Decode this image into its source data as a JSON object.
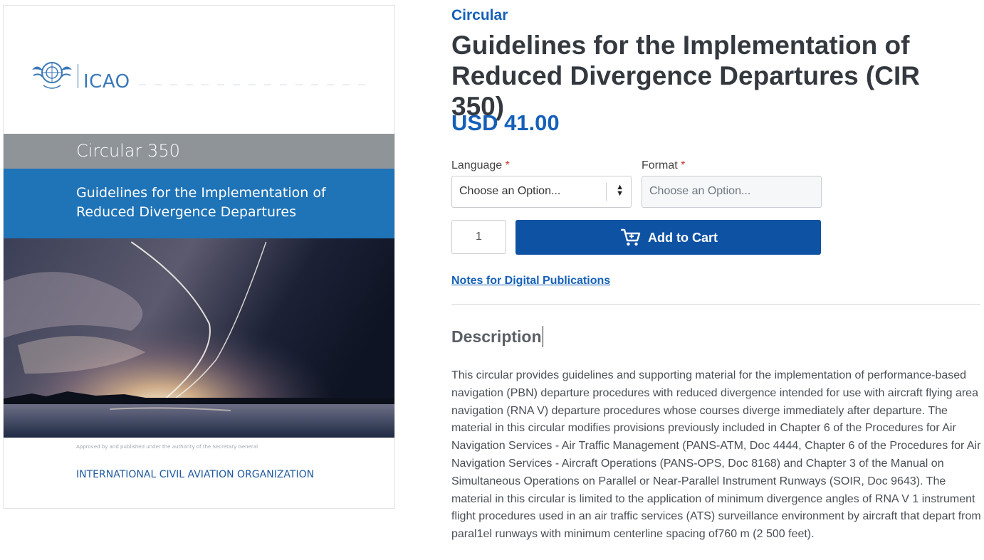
{
  "cover": {
    "logo_text": "ICAO",
    "series_label": "Circular 350",
    "title_line1": "Guidelines for the Implementation of",
    "title_line2": "Reduced Divergence Departures",
    "approved_text": "Approved by and published under the authority of the Secretary General",
    "organization": "INTERNATIONAL CIVIL AVIATION ORGANIZATION",
    "colors": {
      "grey_band": "#8f9498",
      "blue_band": "#1f73b7"
    }
  },
  "product": {
    "category": "Circular",
    "title": "Guidelines for the Implementation of Reduced Divergence Departures (CIR 350)",
    "price": "USD 41.00"
  },
  "options": {
    "language": {
      "label": "Language",
      "required_mark": "*",
      "value": "Choose an Option..."
    },
    "format": {
      "label": "Format",
      "required_mark": "*",
      "placeholder": "Choose an Option..."
    }
  },
  "cart": {
    "quantity": "1",
    "button_label": "Add to Cart",
    "icon": "cart-icon"
  },
  "notes_link": "Notes for Digital Publications",
  "description": {
    "heading": "Description",
    "text": "This circular provides guidelines and supporting material for the implementation of performance-based navigation (PBN) departure procedures with reduced divergence intended for use with aircraft flying area navigation (RNA V) departure procedures whose courses diverge immediately after departure. The material in this circular modifies provisions previously included in Chapter 6 of the Procedures for Air Navigation Services - Air Traffic Management (PANS-ATM, Doc 4444, Chapter 6 of the Procedures for Air Navigation Services - Aircraft Operations (PANS-OPS, Doc 8168) and Chapter 3 of the Manual on Simultaneous Operations on Parallel or Near-Parallel Instrument Runways (SOIR, Doc 9643). The material in this circular is limited to the application of minimum divergence angles of RNA V 1 instrument flight procedures used in an air traffic services (ATS) surveillance environment by aircraft that depart from paral1el runways with minimum centerline spacing of760 m (2 500 feet)."
  },
  "theme": {
    "accent": "#1560b8",
    "button": "#0e52a3",
    "required": "#d0342c"
  }
}
